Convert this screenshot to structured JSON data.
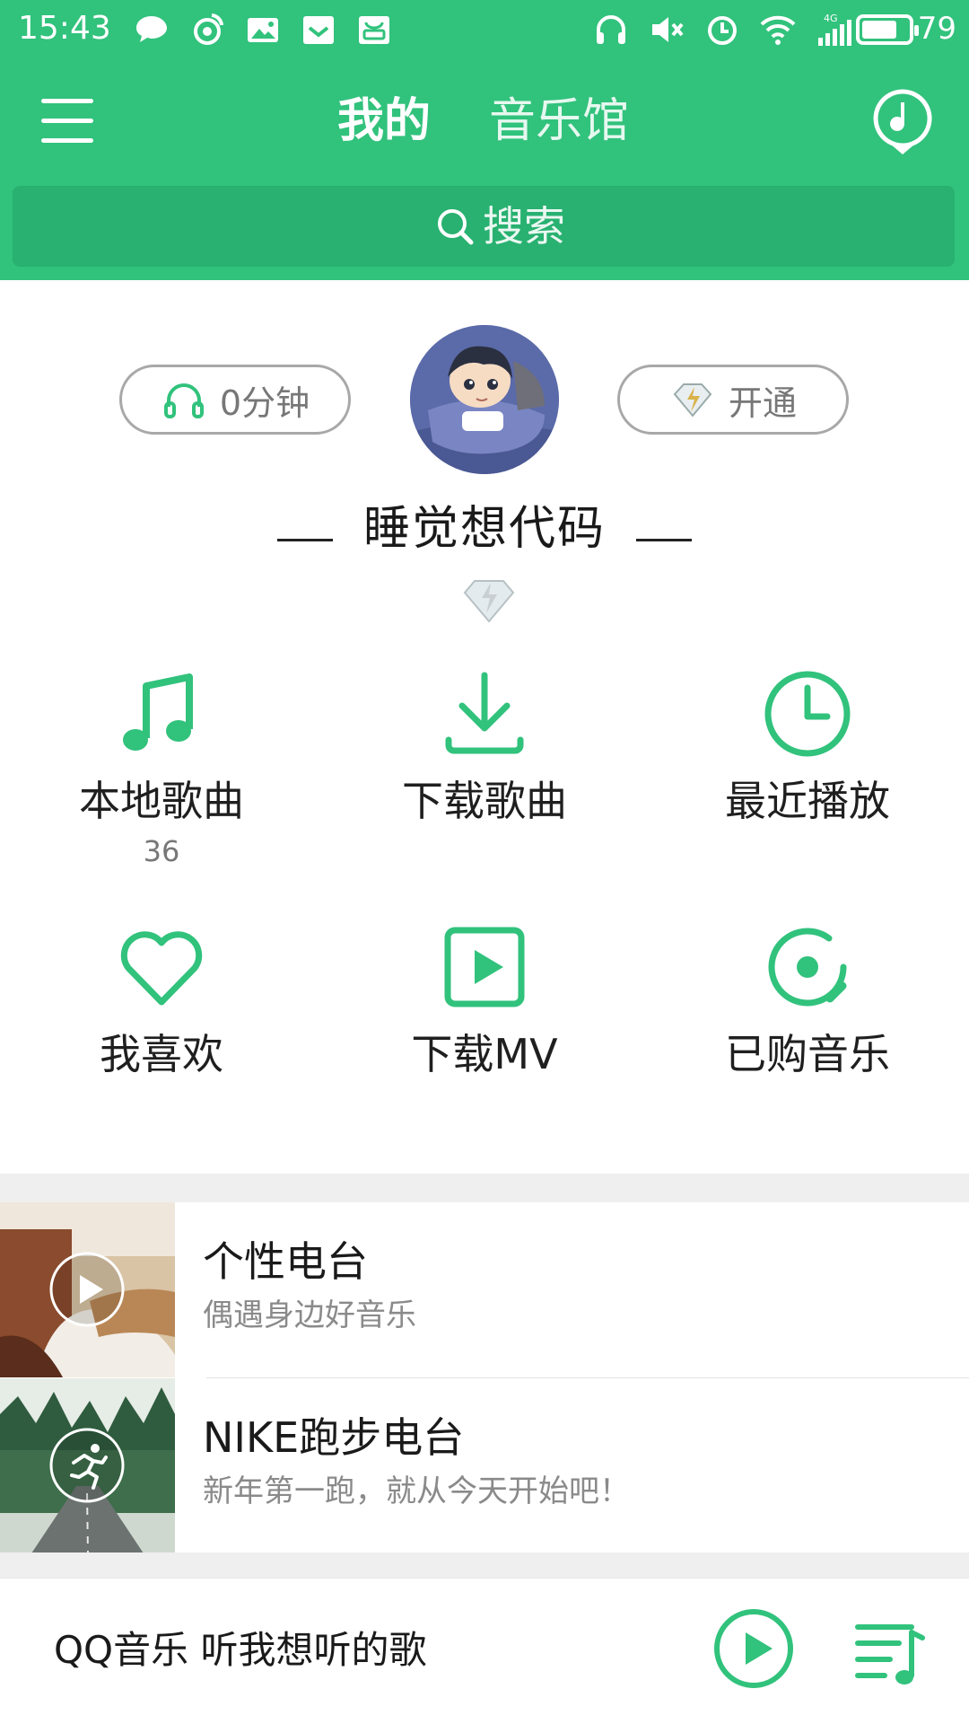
{
  "status_bar": {
    "time": "15:43",
    "network": "4G",
    "battery": "79",
    "battery_level": 0.79,
    "left_icons": [
      "chat-bubble-icon",
      "weibo-icon",
      "image-notify-icon",
      "mail-notify-icon",
      "app-notify-icon"
    ],
    "right_icons": [
      "headphones-icon",
      "mute-icon",
      "alarm-icon",
      "wifi-icon",
      "signal-icon",
      "battery-icon"
    ]
  },
  "nav": {
    "tabs": [
      {
        "label": "我的",
        "active": true
      },
      {
        "label": "音乐馆",
        "active": false
      }
    ],
    "menu_icon": "hamburger-icon",
    "right_icon": "radio-icon"
  },
  "search": {
    "placeholder": "搜索"
  },
  "profile": {
    "listen_time": "0分钟",
    "vip_label": "开通",
    "username": "睡觉想代码"
  },
  "grid": [
    {
      "label": "本地歌曲",
      "count": "36",
      "icon": "music-note-icon"
    },
    {
      "label": "下载歌曲",
      "count": "",
      "icon": "download-icon"
    },
    {
      "label": "最近播放",
      "count": "",
      "icon": "clock-icon"
    },
    {
      "label": "我喜欢",
      "count": "",
      "icon": "heart-icon"
    },
    {
      "label": "下载MV",
      "count": "",
      "icon": "mv-play-icon"
    },
    {
      "label": "已购音乐",
      "count": "",
      "icon": "disc-icon"
    }
  ],
  "radios": [
    {
      "title": "个性电台",
      "subtitle": "偶遇身边好音乐",
      "icon": "play-circle-icon"
    },
    {
      "title": "NIKE跑步电台",
      "subtitle": "新年第一跑，就从今天开始吧！",
      "icon": "runner-icon"
    }
  ],
  "player": {
    "text": "QQ音乐 听我想听的歌"
  },
  "colors": {
    "brand_green": "#31c27c",
    "search_bg": "#28b170",
    "text_primary": "#1a1a1a",
    "text_secondary": "#8a8a8a"
  }
}
